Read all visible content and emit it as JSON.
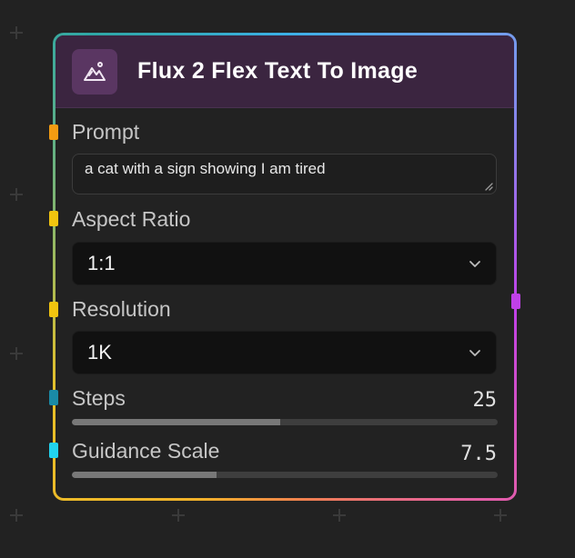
{
  "node": {
    "title": "Flux 2 Flex Text To Image",
    "icon": "image-mountains-icon",
    "header_color": "#3b2540"
  },
  "fields": {
    "prompt": {
      "label": "Prompt",
      "value": "a cat with a sign showing I am tired"
    },
    "aspect_ratio": {
      "label": "Aspect Ratio",
      "value": "1:1"
    },
    "resolution": {
      "label": "Resolution",
      "value": "1K"
    },
    "steps": {
      "label": "Steps",
      "value": "25",
      "fill_fraction": 0.49
    },
    "guidance_scale": {
      "label": "Guidance Scale",
      "value": "7.5",
      "fill_fraction": 0.34
    }
  },
  "ports": {
    "prompt_color": "#f39c12",
    "aspect_ratio_color": "#f1c40f",
    "resolution_color": "#f1c40f",
    "steps_color": "#1a8aa6",
    "guidance_scale_color": "#22d3ee",
    "output_color": "#c040e8"
  }
}
